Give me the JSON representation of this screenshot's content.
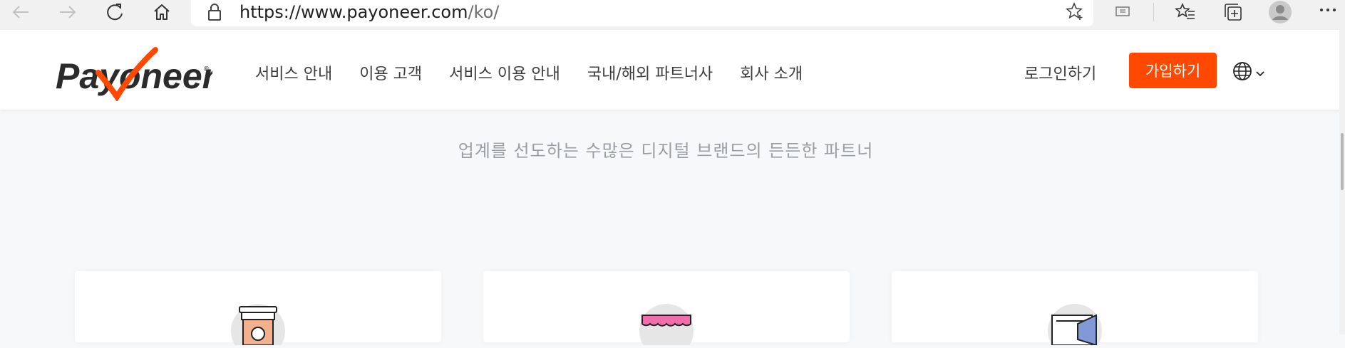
{
  "browser": {
    "url_host": "https://www.payoneer.com",
    "url_path": "/ko/"
  },
  "header": {
    "logo_text": "Payoneer",
    "menu": [
      {
        "label": "서비스 안내"
      },
      {
        "label": "이용 고객"
      },
      {
        "label": "서비스 이용 안내"
      },
      {
        "label": "국내/해외 파트너사"
      },
      {
        "label": "회사 소개"
      }
    ],
    "login_label": "로그인하기",
    "signup_label": "가입하기"
  },
  "main": {
    "tagline": "업계를 선도하는 수많은 디지털 브랜드의 든든한 파트너"
  },
  "colors": {
    "accent": "#ff4800",
    "tagline": "#9a9ea3"
  },
  "icons": [
    "back-icon",
    "forward-icon",
    "refresh-icon",
    "home-icon",
    "lock-icon",
    "star-icon",
    "reading-view-icon",
    "favorites-icon",
    "collections-icon",
    "profile-icon",
    "more-icon",
    "globe-icon",
    "chevron-down-icon"
  ]
}
